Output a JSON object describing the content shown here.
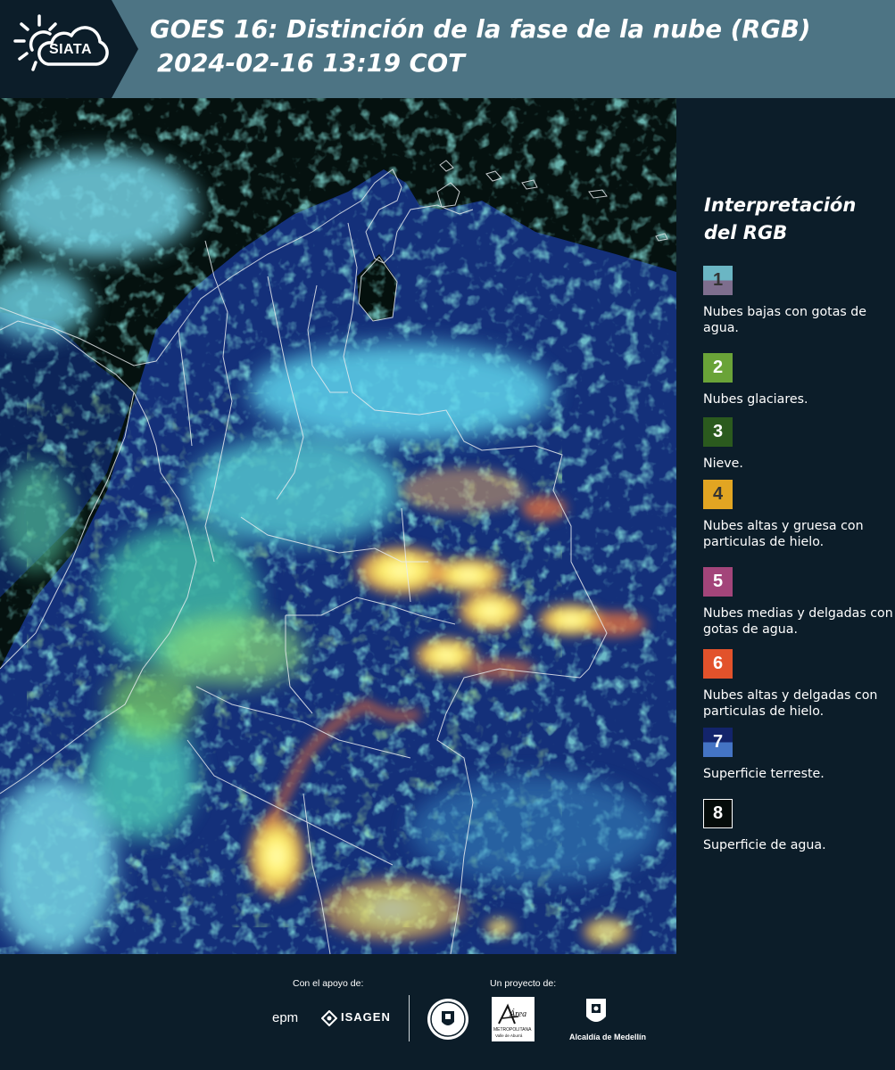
{
  "header": {
    "logo_text": "SIATA",
    "title_line1": "GOES 16: Distinción de la fase de la nube (RGB)",
    "title_line2": "2024-02-16 13:19 COT"
  },
  "legend": {
    "title_line1": "Interpretación",
    "title_line2": "del RGB",
    "items": [
      {
        "number": "1",
        "label": "Nubes bajas con gotas de agua.",
        "color_top": "#6bb6c4",
        "color_bottom": "#7e6e8e",
        "text_color": "#333333"
      },
      {
        "number": "2",
        "label": "Nubes glaciares.",
        "color_top": "#6aa338",
        "color_bottom": "#6aa338",
        "text_color": "#ffffff"
      },
      {
        "number": "3",
        "label": "Nieve.",
        "color_top": "#2b5a1e",
        "color_bottom": "#2b5a1e",
        "text_color": "#ffffff"
      },
      {
        "number": "4",
        "label": "Nubes altas y gruesa con particulas de hielo.",
        "color_top": "#e2a522",
        "color_bottom": "#e2a522",
        "text_color": "#333333"
      },
      {
        "number": "5",
        "label": "Nubes medias y delgadas con gotas de agua.",
        "color_top": "#a3457a",
        "color_bottom": "#a3457a",
        "text_color": "#ffffff"
      },
      {
        "number": "6",
        "label": "Nubes altas y delgadas con particulas de hielo.",
        "color_top": "#e2522b",
        "color_bottom": "#e2522b",
        "text_color": "#ffffff"
      },
      {
        "number": "7",
        "label": "Superficie terreste.",
        "color_top": "#13246b",
        "color_bottom": "#4474c4",
        "text_color": "#ffffff"
      },
      {
        "number": "8",
        "label": "Superficie de agua.",
        "color_top": "#050c0a",
        "color_bottom": "#050c0a",
        "text_color": "#ffffff"
      }
    ]
  },
  "footer": {
    "support_caption": "Con el apoyo de:",
    "project_caption": "Un proyecto de:",
    "epm_text": "epm",
    "isagen_text": "ISAGEN",
    "metropolitana_text": "METROPOLITANA",
    "area_text": "Área",
    "valle_text": "Valle de Aburrá",
    "alcaldia_text": "Alcaldía de Medellín"
  },
  "colors": {
    "header_bg": "#4d7484",
    "logo_tab_bg": "#0c1d29",
    "page_bg": "#0c1d29",
    "map_land": "#14307a",
    "map_water": "#05110f"
  }
}
